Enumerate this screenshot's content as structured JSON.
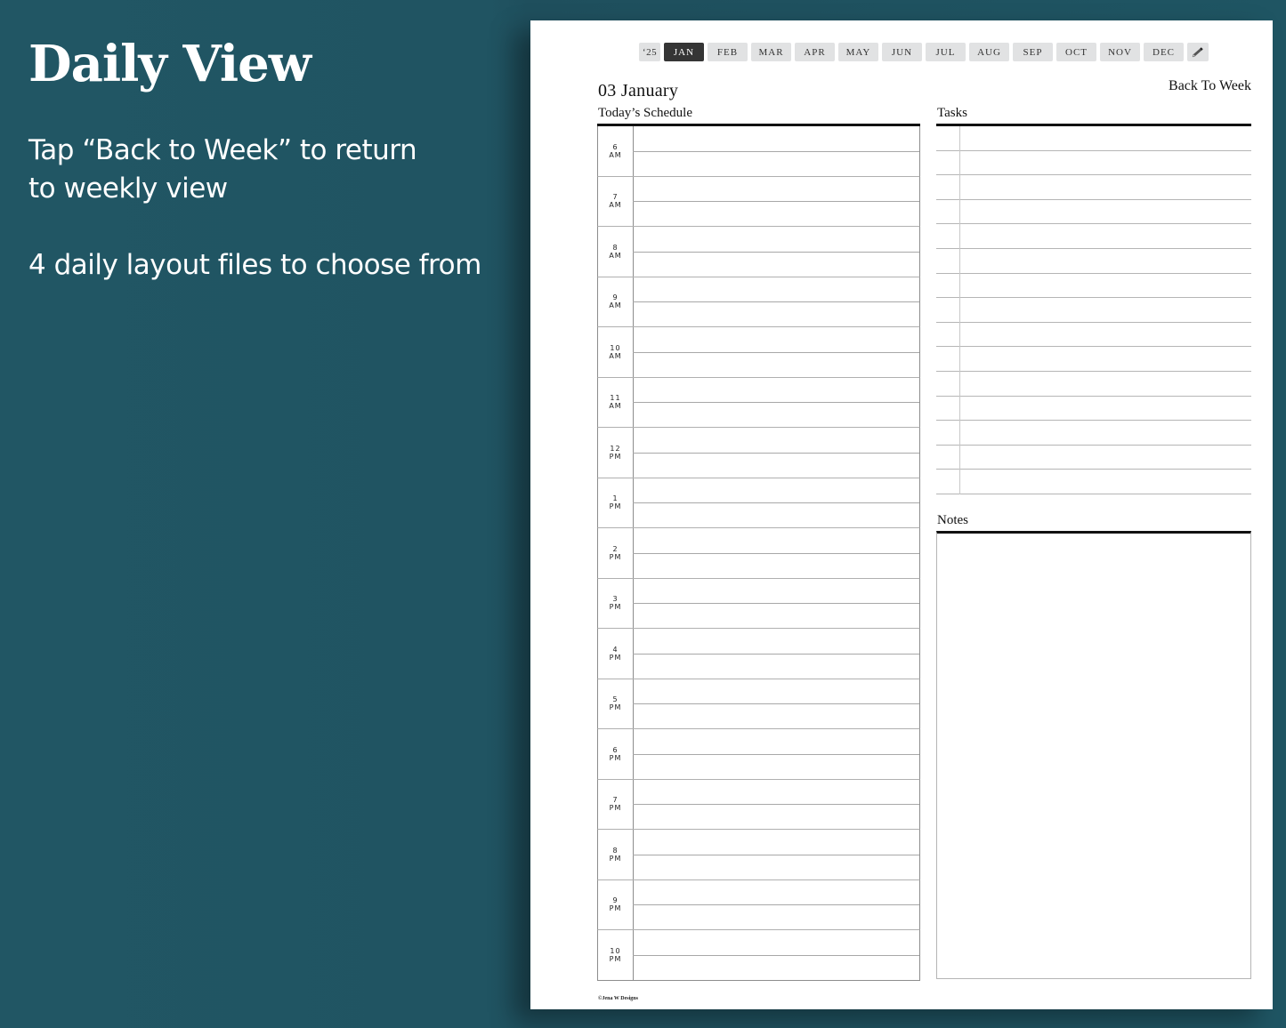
{
  "promo": {
    "title": "Daily View",
    "line1": "Tap “Back to Week” to return",
    "line2": "to weekly view",
    "line3": "4 daily layout files to choose from"
  },
  "planner": {
    "year_tab": "‘25",
    "months": [
      "JAN",
      "FEB",
      "MAR",
      "APR",
      "MAY",
      "JUN",
      "JUL",
      "AUG",
      "SEP",
      "OCT",
      "NOV",
      "DEC"
    ],
    "active_month": "JAN",
    "pencil_icon": "pencil-icon",
    "date": "03 January",
    "back_link": "Back To Week",
    "schedule_title": "Today’s Schedule",
    "hours": [
      {
        "h": "6",
        "p": "AM"
      },
      {
        "h": "7",
        "p": "AM"
      },
      {
        "h": "8",
        "p": "AM"
      },
      {
        "h": "9",
        "p": "AM"
      },
      {
        "h": "10",
        "p": "AM"
      },
      {
        "h": "11",
        "p": "AM"
      },
      {
        "h": "12",
        "p": "PM"
      },
      {
        "h": "1",
        "p": "PM"
      },
      {
        "h": "2",
        "p": "PM"
      },
      {
        "h": "3",
        "p": "PM"
      },
      {
        "h": "4",
        "p": "PM"
      },
      {
        "h": "5",
        "p": "PM"
      },
      {
        "h": "6",
        "p": "PM"
      },
      {
        "h": "7",
        "p": "PM"
      },
      {
        "h": "8",
        "p": "PM"
      },
      {
        "h": "9",
        "p": "PM"
      },
      {
        "h": "10",
        "p": "PM"
      }
    ],
    "tasks_title": "Tasks",
    "task_rows": 15,
    "notes_title": "Notes",
    "copyright": "©Jena W Designs"
  }
}
